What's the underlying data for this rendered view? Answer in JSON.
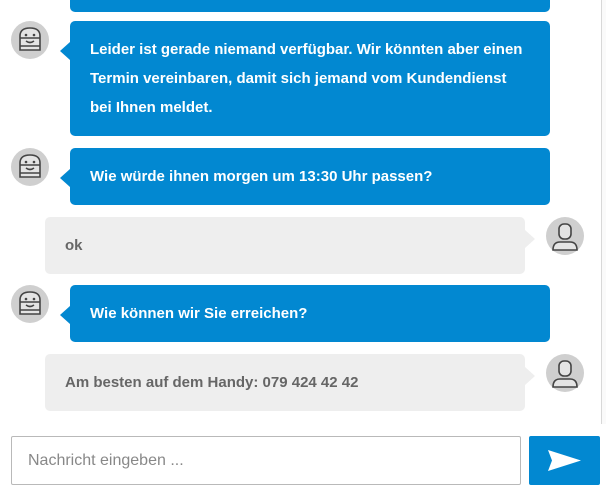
{
  "colors": {
    "bot_bubble": "#0288d1",
    "user_bubble": "#eeeeee",
    "bot_text": "#ffffff",
    "user_text": "#666666",
    "send_button": "#0288d1"
  },
  "messages": [
    {
      "sender": "bot",
      "lines": [
        ""
      ]
    },
    {
      "sender": "bot",
      "lines": [
        "Leider ist gerade niemand verfügbar. Wir könnten aber einen",
        "Termin vereinbaren, damit sich jemand vom Kundendienst",
        "bei Ihnen meldet."
      ]
    },
    {
      "sender": "bot",
      "lines": [
        "Wie würde ihnen morgen um 13:30 Uhr passen?"
      ]
    },
    {
      "sender": "user",
      "lines": [
        "ok"
      ]
    },
    {
      "sender": "bot",
      "lines": [
        "Wie können wir Sie erreichen?"
      ]
    },
    {
      "sender": "user",
      "lines": [
        "Am besten auf dem Handy: 079 424 42 42"
      ]
    }
  ],
  "composer": {
    "placeholder": "Nachricht eingeben ...",
    "send_icon": "paper-plane-icon"
  },
  "avatars": {
    "bot_icon": "bot-avatar-icon",
    "user_icon": "user-avatar-icon"
  }
}
